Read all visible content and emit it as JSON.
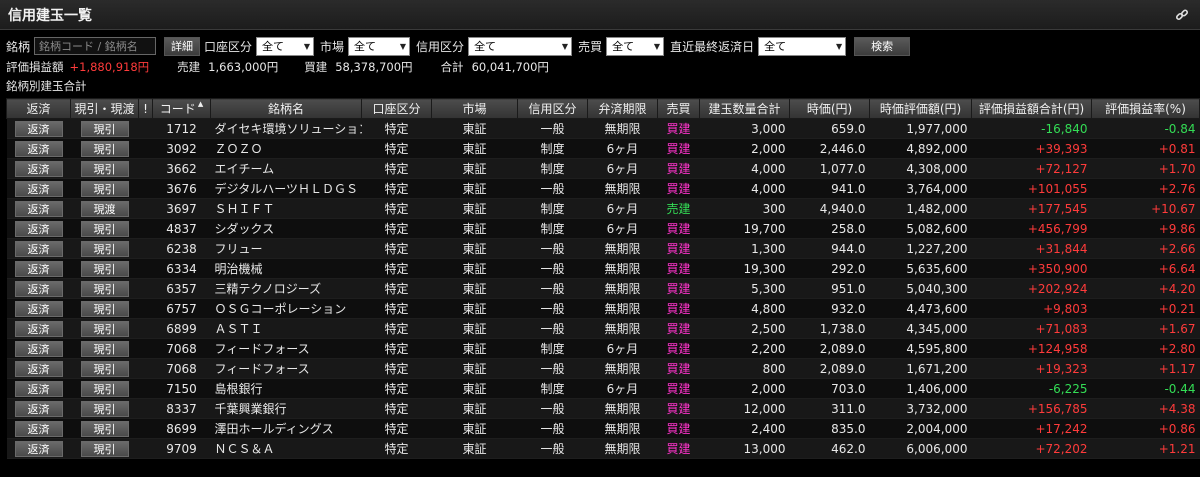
{
  "window": {
    "title": "信用建玉一覧",
    "link_icon": "link-icon"
  },
  "filters": {
    "stock_label": "銘柄",
    "stock_placeholder": "銘柄コード / 銘柄名",
    "detail_button": "詳細",
    "account_label": "口座区分",
    "account_value": "全て",
    "market_label": "市場",
    "market_value": "全て",
    "credit_label": "信用区分",
    "credit_value": "全て",
    "trade_label": "売買",
    "trade_value": "全て",
    "due_label": "直近最終返済日",
    "due_value": "全て",
    "search_button": "検索"
  },
  "summary": {
    "pl_label": "評価損益額",
    "pl_value": "+1,880,918円",
    "sell_label": "売建",
    "sell_value": "1,663,000円",
    "buy_label": "買建",
    "buy_value": "58,378,700円",
    "total_label": "合計",
    "total_value": "60,041,700円"
  },
  "subheading": "銘柄別建玉合計",
  "colors": {
    "buy": "#ff33cc",
    "sell": "#33dd55",
    "gain": "#ff3b3b",
    "loss": "#33dd55"
  },
  "columns": [
    "返済",
    "現引・現渡",
    "!",
    "コード",
    "銘柄名",
    "口座区分",
    "市場",
    "信用区分",
    "弁済期限",
    "売買",
    "建玉数量合計",
    "時価(円)",
    "時価評価額(円)",
    "評価損益額合計(円)",
    "評価損益率(%)"
  ],
  "rows": [
    {
      "repay": "返済",
      "action": "現引",
      "code": "1712",
      "name": "ダイセキ環境ソリューション",
      "account": "特定",
      "market": "東証",
      "credit": "一般",
      "due": "無期限",
      "side": "買建",
      "qty": "3,000",
      "price": "659.0",
      "value": "1,977,000",
      "pl": "-16,840",
      "rate": "-0.84",
      "sign": "loss"
    },
    {
      "repay": "返済",
      "action": "現引",
      "code": "3092",
      "name": "ＺＯＺＯ",
      "account": "特定",
      "market": "東証",
      "credit": "制度",
      "due": "6ヶ月",
      "side": "買建",
      "qty": "2,000",
      "price": "2,446.0",
      "value": "4,892,000",
      "pl": "+39,393",
      "rate": "+0.81",
      "sign": "gain"
    },
    {
      "repay": "返済",
      "action": "現引",
      "code": "3662",
      "name": "エイチーム",
      "account": "特定",
      "market": "東証",
      "credit": "制度",
      "due": "6ヶ月",
      "side": "買建",
      "qty": "4,000",
      "price": "1,077.0",
      "value": "4,308,000",
      "pl": "+72,127",
      "rate": "+1.70",
      "sign": "gain"
    },
    {
      "repay": "返済",
      "action": "現引",
      "code": "3676",
      "name": "デジタルハーツＨＬＤＧＳ",
      "account": "特定",
      "market": "東証",
      "credit": "一般",
      "due": "無期限",
      "side": "買建",
      "qty": "4,000",
      "price": "941.0",
      "value": "3,764,000",
      "pl": "+101,055",
      "rate": "+2.76",
      "sign": "gain"
    },
    {
      "repay": "返済",
      "action": "現渡",
      "code": "3697",
      "name": "ＳＨＩＦＴ",
      "account": "特定",
      "market": "東証",
      "credit": "制度",
      "due": "6ヶ月",
      "side": "売建",
      "qty": "300",
      "price": "4,940.0",
      "value": "1,482,000",
      "pl": "+177,545",
      "rate": "+10.67",
      "sign": "gain"
    },
    {
      "repay": "返済",
      "action": "現引",
      "code": "4837",
      "name": "シダックス",
      "account": "特定",
      "market": "東証",
      "credit": "制度",
      "due": "6ヶ月",
      "side": "買建",
      "qty": "19,700",
      "price": "258.0",
      "value": "5,082,600",
      "pl": "+456,799",
      "rate": "+9.86",
      "sign": "gain"
    },
    {
      "repay": "返済",
      "action": "現引",
      "code": "6238",
      "name": "フリュー",
      "account": "特定",
      "market": "東証",
      "credit": "一般",
      "due": "無期限",
      "side": "買建",
      "qty": "1,300",
      "price": "944.0",
      "value": "1,227,200",
      "pl": "+31,844",
      "rate": "+2.66",
      "sign": "gain"
    },
    {
      "repay": "返済",
      "action": "現引",
      "code": "6334",
      "name": "明治機械",
      "account": "特定",
      "market": "東証",
      "credit": "一般",
      "due": "無期限",
      "side": "買建",
      "qty": "19,300",
      "price": "292.0",
      "value": "5,635,600",
      "pl": "+350,900",
      "rate": "+6.64",
      "sign": "gain"
    },
    {
      "repay": "返済",
      "action": "現引",
      "code": "6357",
      "name": "三精テクノロジーズ",
      "account": "特定",
      "market": "東証",
      "credit": "一般",
      "due": "無期限",
      "side": "買建",
      "qty": "5,300",
      "price": "951.0",
      "value": "5,040,300",
      "pl": "+202,924",
      "rate": "+4.20",
      "sign": "gain"
    },
    {
      "repay": "返済",
      "action": "現引",
      "code": "6757",
      "name": "ＯＳＧコーポレーション",
      "account": "特定",
      "market": "東証",
      "credit": "一般",
      "due": "無期限",
      "side": "買建",
      "qty": "4,800",
      "price": "932.0",
      "value": "4,473,600",
      "pl": "+9,803",
      "rate": "+0.21",
      "sign": "gain"
    },
    {
      "repay": "返済",
      "action": "現引",
      "code": "6899",
      "name": "ＡＳＴＩ",
      "account": "特定",
      "market": "東証",
      "credit": "一般",
      "due": "無期限",
      "side": "買建",
      "qty": "2,500",
      "price": "1,738.0",
      "value": "4,345,000",
      "pl": "+71,083",
      "rate": "+1.67",
      "sign": "gain"
    },
    {
      "repay": "返済",
      "action": "現引",
      "code": "7068",
      "name": "フィードフォース",
      "account": "特定",
      "market": "東証",
      "credit": "制度",
      "due": "6ヶ月",
      "side": "買建",
      "qty": "2,200",
      "price": "2,089.0",
      "value": "4,595,800",
      "pl": "+124,958",
      "rate": "+2.80",
      "sign": "gain"
    },
    {
      "repay": "返済",
      "action": "現引",
      "code": "7068",
      "name": "フィードフォース",
      "account": "特定",
      "market": "東証",
      "credit": "一般",
      "due": "無期限",
      "side": "買建",
      "qty": "800",
      "price": "2,089.0",
      "value": "1,671,200",
      "pl": "+19,323",
      "rate": "+1.17",
      "sign": "gain"
    },
    {
      "repay": "返済",
      "action": "現引",
      "code": "7150",
      "name": "島根銀行",
      "account": "特定",
      "market": "東証",
      "credit": "制度",
      "due": "6ヶ月",
      "side": "買建",
      "qty": "2,000",
      "price": "703.0",
      "value": "1,406,000",
      "pl": "-6,225",
      "rate": "-0.44",
      "sign": "loss"
    },
    {
      "repay": "返済",
      "action": "現引",
      "code": "8337",
      "name": "千葉興業銀行",
      "account": "特定",
      "market": "東証",
      "credit": "一般",
      "due": "無期限",
      "side": "買建",
      "qty": "12,000",
      "price": "311.0",
      "value": "3,732,000",
      "pl": "+156,785",
      "rate": "+4.38",
      "sign": "gain"
    },
    {
      "repay": "返済",
      "action": "現引",
      "code": "8699",
      "name": "澤田ホールディングス",
      "account": "特定",
      "market": "東証",
      "credit": "一般",
      "due": "無期限",
      "side": "買建",
      "qty": "2,400",
      "price": "835.0",
      "value": "2,004,000",
      "pl": "+17,242",
      "rate": "+0.86",
      "sign": "gain"
    },
    {
      "repay": "返済",
      "action": "現引",
      "code": "9709",
      "name": "ＮＣＳ＆Ａ",
      "account": "特定",
      "market": "東証",
      "credit": "一般",
      "due": "無期限",
      "side": "買建",
      "qty": "13,000",
      "price": "462.0",
      "value": "6,006,000",
      "pl": "+72,202",
      "rate": "+1.21",
      "sign": "gain"
    }
  ]
}
